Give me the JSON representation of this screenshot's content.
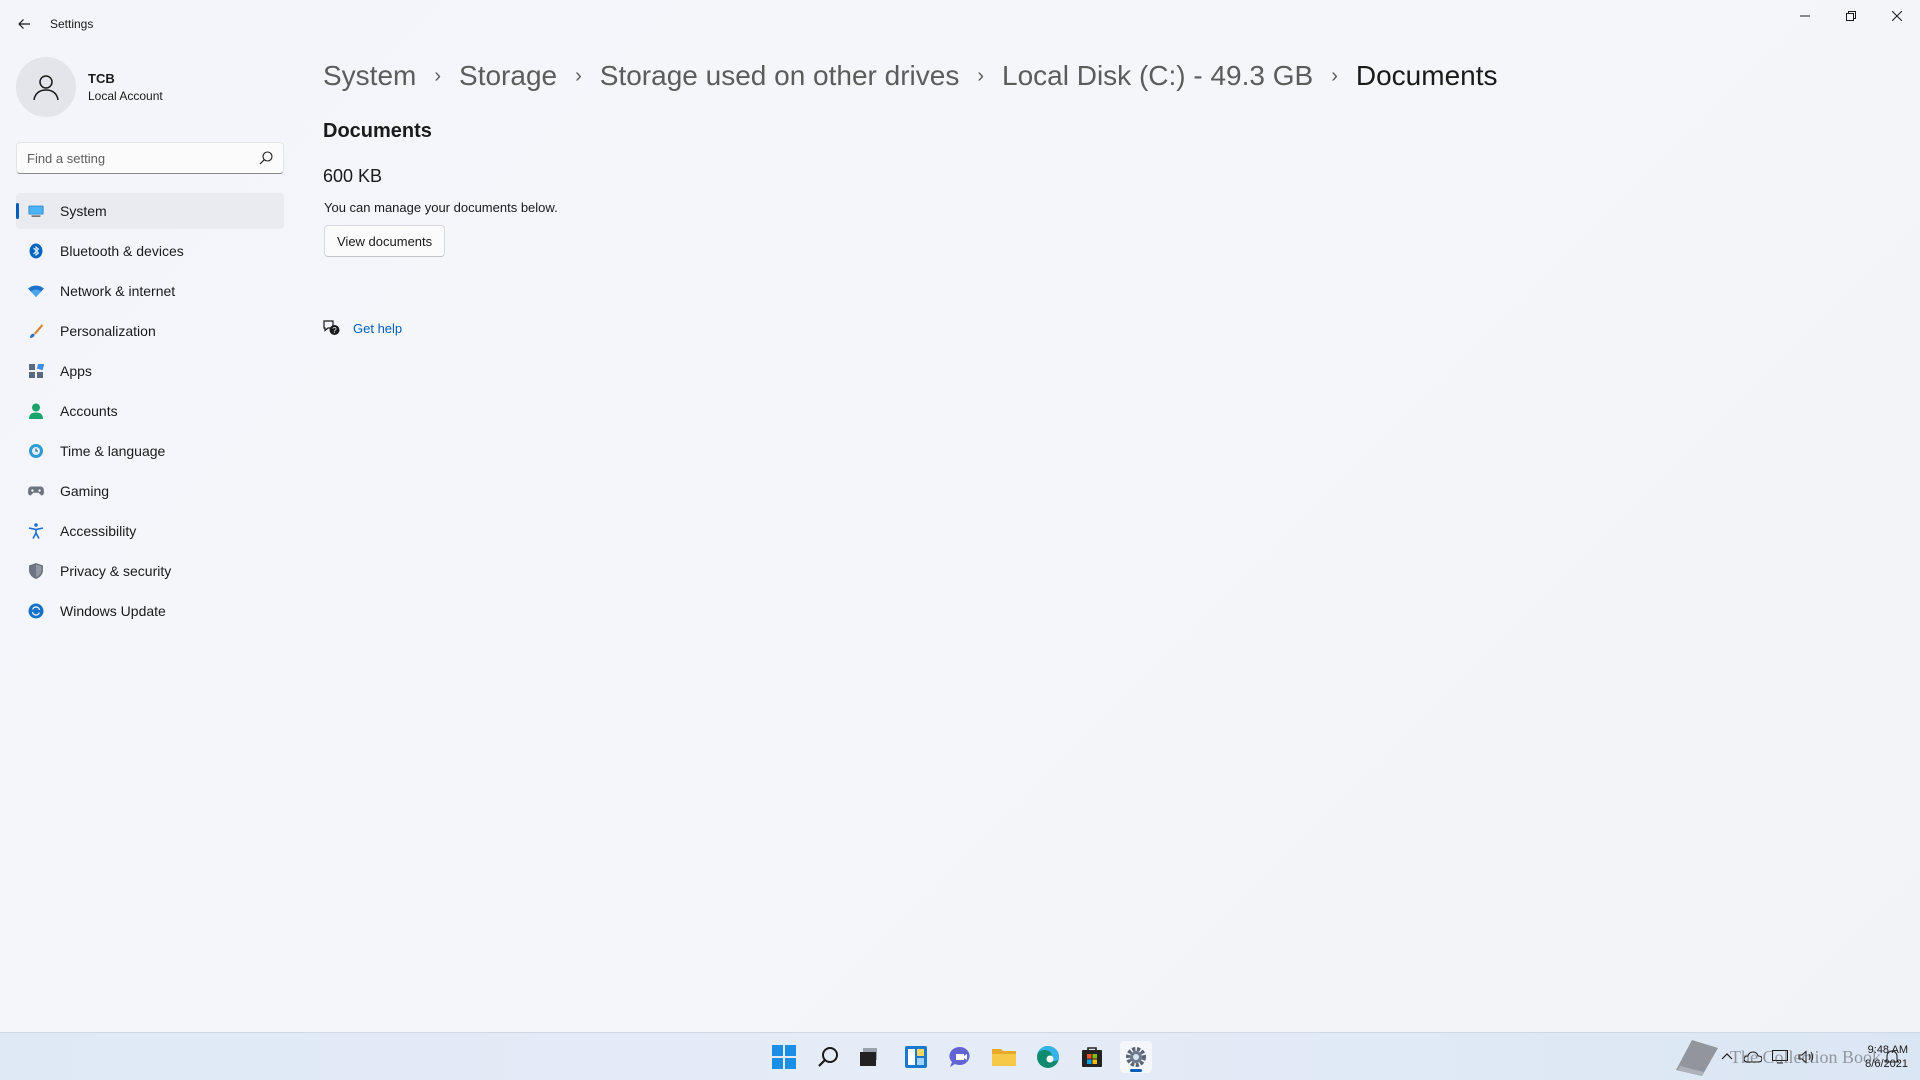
{
  "window": {
    "title": "Settings"
  },
  "profile": {
    "name": "TCB",
    "account_type": "Local Account"
  },
  "search": {
    "placeholder": "Find a setting"
  },
  "nav": {
    "items": [
      {
        "label": "System",
        "icon": "system-icon",
        "active": true
      },
      {
        "label": "Bluetooth & devices",
        "icon": "bluetooth-icon"
      },
      {
        "label": "Network & internet",
        "icon": "wifi-icon"
      },
      {
        "label": "Personalization",
        "icon": "brush-icon"
      },
      {
        "label": "Apps",
        "icon": "apps-icon"
      },
      {
        "label": "Accounts",
        "icon": "person-icon"
      },
      {
        "label": "Time & language",
        "icon": "globe-clock-icon"
      },
      {
        "label": "Gaming",
        "icon": "gamepad-icon"
      },
      {
        "label": "Accessibility",
        "icon": "accessibility-icon"
      },
      {
        "label": "Privacy & security",
        "icon": "shield-icon"
      },
      {
        "label": "Windows Update",
        "icon": "update-icon"
      }
    ]
  },
  "breadcrumb": {
    "items": [
      "System",
      "Storage",
      "Storage used on other drives",
      "Local Disk (C:) - 49.3 GB",
      "Documents"
    ]
  },
  "main": {
    "section_title": "Documents",
    "size": "600 KB",
    "description": "You can manage your documents below.",
    "view_button": "View documents",
    "get_help": "Get help"
  },
  "taskbar": {
    "icons": [
      "windows-start-icon",
      "search-icon",
      "task-view-icon",
      "widgets-icon",
      "teams-chat-icon",
      "file-explorer-icon",
      "edge-icon",
      "store-icon",
      "settings-icon"
    ],
    "active": "settings-icon"
  },
  "clock": {
    "time": "9:48 AM",
    "date": "8/6/2021"
  },
  "watermark": {
    "text": "The Collection Book"
  },
  "colors": {
    "accent": "#005fb8",
    "link": "#005fb8"
  }
}
